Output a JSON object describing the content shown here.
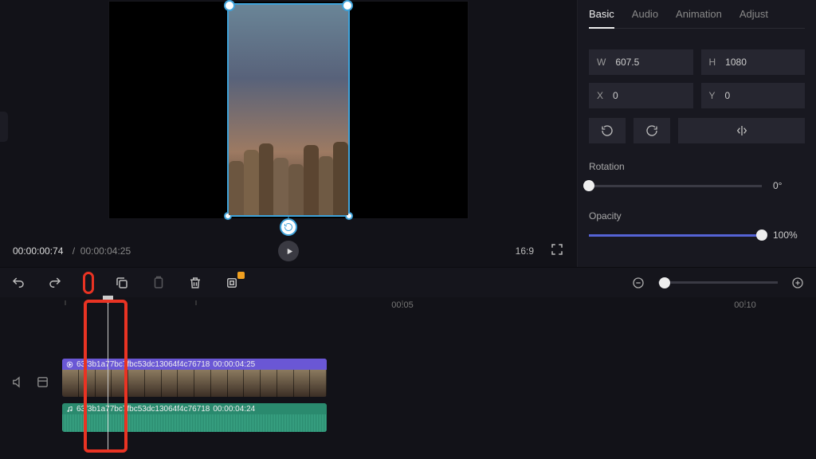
{
  "tabs": {
    "basic": "Basic",
    "audio": "Audio",
    "animation": "Animation",
    "adjust": "Adjust"
  },
  "dims": {
    "w_label": "W",
    "w_val": "607.5",
    "h_label": "H",
    "h_val": "1080",
    "x_label": "X",
    "x_val": "0",
    "y_label": "Y",
    "y_val": "0"
  },
  "rotation": {
    "label": "Rotation",
    "value": "0°"
  },
  "opacity": {
    "label": "Opacity",
    "value": "100%"
  },
  "transport": {
    "current": "00:00:00:74",
    "sep": "/",
    "duration": "00:00:04:25",
    "aspect": "16:9"
  },
  "ruler": {
    "t5": "00:05",
    "t10": "00:10"
  },
  "clip": {
    "video_name": "63f3b1a77bc7fbc53dc13064f4c76718",
    "video_dur": "00:00:04:25",
    "audio_name": "63f3b1a77bc7fbc53dc13064f4c76718",
    "audio_dur": "00:00:04:24"
  }
}
